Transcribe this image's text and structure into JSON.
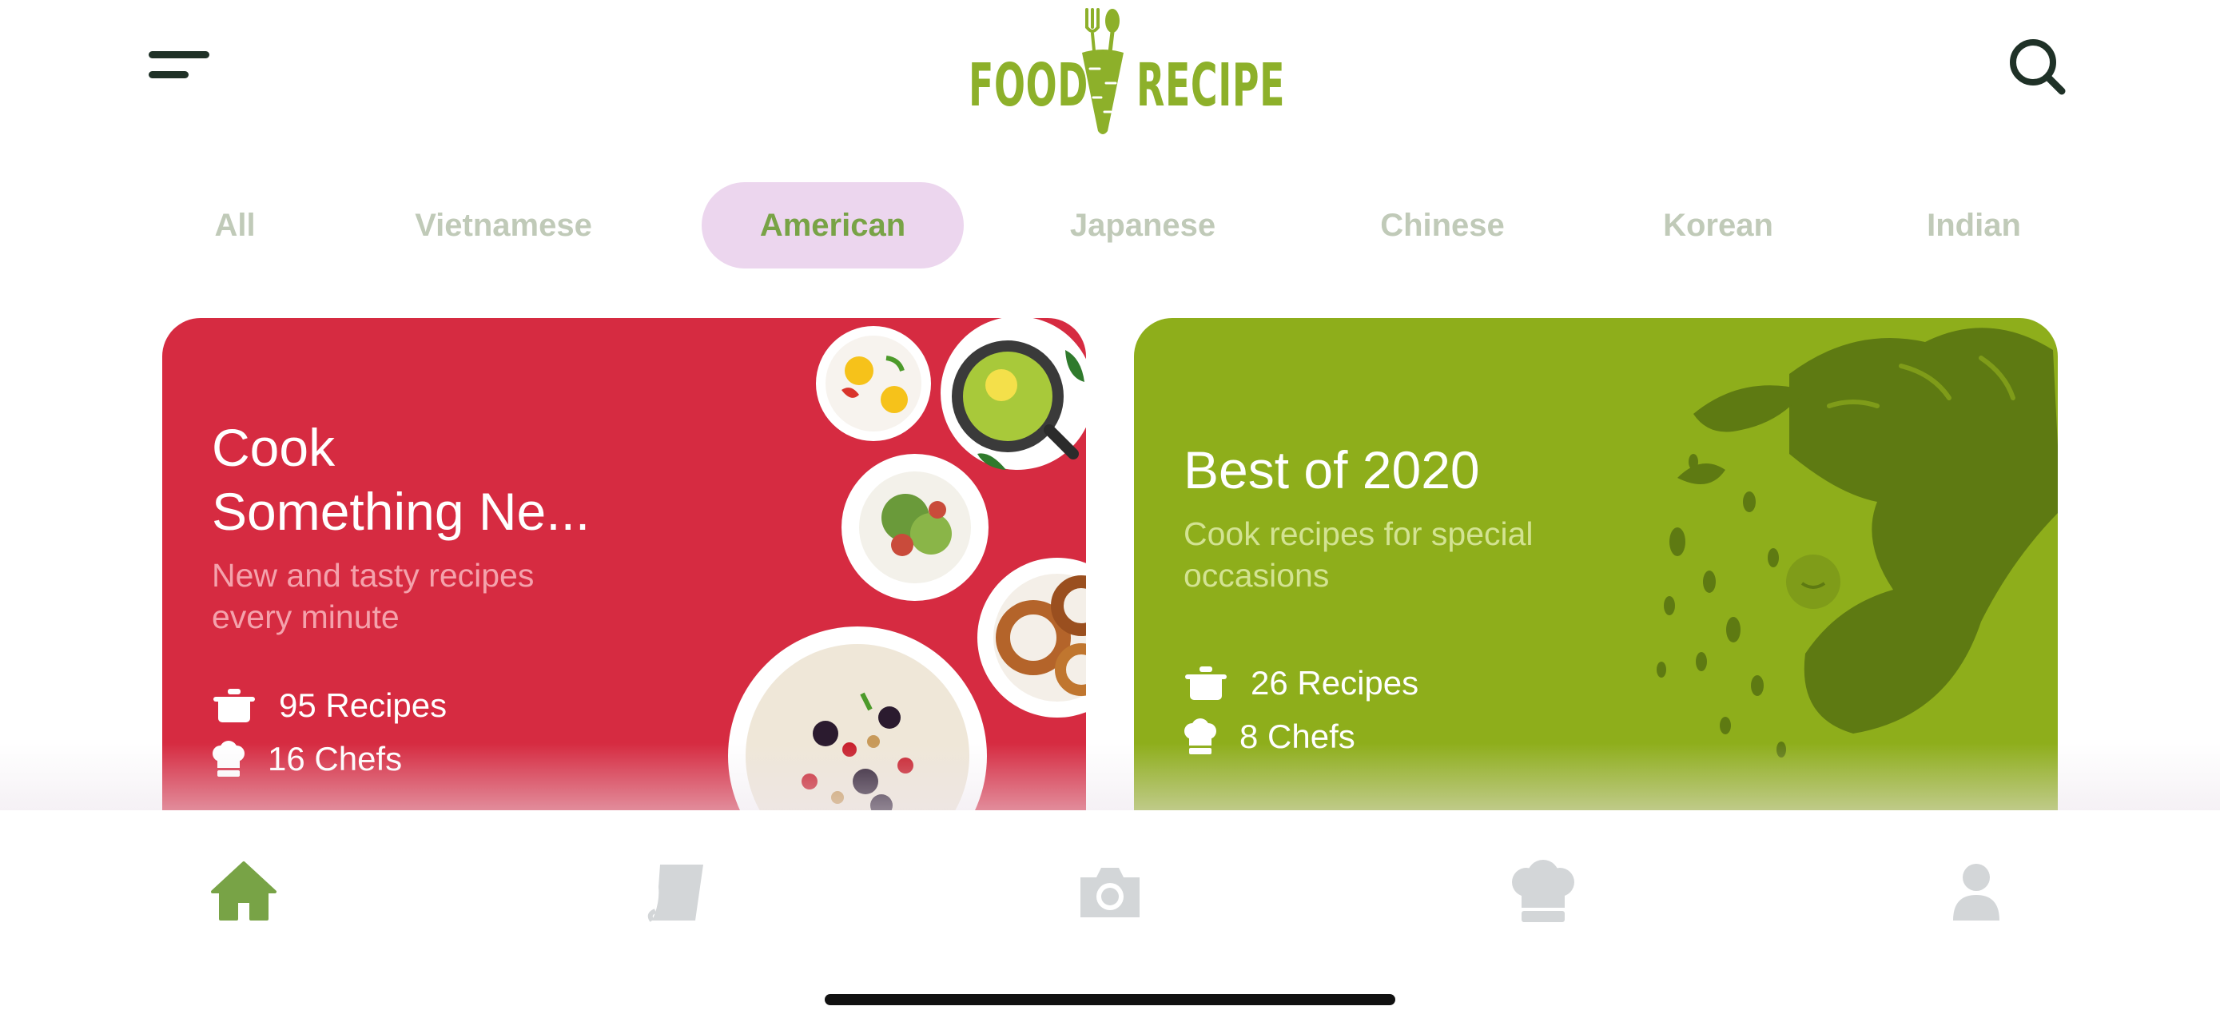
{
  "app": {
    "logo_left": "FOOD",
    "logo_right": "RECIPE"
  },
  "header": {
    "menu_icon": "hamburger-menu-icon",
    "search_icon": "search-icon"
  },
  "categories": [
    {
      "label": "All",
      "active": false
    },
    {
      "label": "Vietnamese",
      "active": false
    },
    {
      "label": "American",
      "active": true
    },
    {
      "label": "Japanese",
      "active": false
    },
    {
      "label": "Chinese",
      "active": false
    },
    {
      "label": "Korean",
      "active": false
    },
    {
      "label": "Indian",
      "active": false
    }
  ],
  "cards": [
    {
      "title_line1": "Cook",
      "title_line2": "Something Ne...",
      "subtitle_line1": "New and tasty recipes",
      "subtitle_line2": "every minute",
      "recipes": "95 Recipes",
      "chefs": "16 Chefs",
      "color": "#d62b41"
    },
    {
      "title_line1": "Best of 2020",
      "subtitle_line1": "Cook recipes for special",
      "subtitle_line2": "occasions",
      "recipes": "26 Recipes",
      "chefs": "8 Chefs",
      "color": "#8eae1b"
    }
  ],
  "bottom_nav": [
    {
      "icon": "home-icon",
      "active": true
    },
    {
      "icon": "recipe-book-icon",
      "active": false
    },
    {
      "icon": "camera-icon",
      "active": false
    },
    {
      "icon": "chef-hat-icon",
      "active": false
    },
    {
      "icon": "profile-icon",
      "active": false
    }
  ],
  "colors": {
    "brand_green": "#8db02a",
    "active_tab_bg": "#ecd6ee",
    "active_tab_text": "#78a346",
    "inactive_tab_text": "#c0cab8",
    "nav_active": "#78a346",
    "nav_inactive": "#d3d6d8"
  }
}
